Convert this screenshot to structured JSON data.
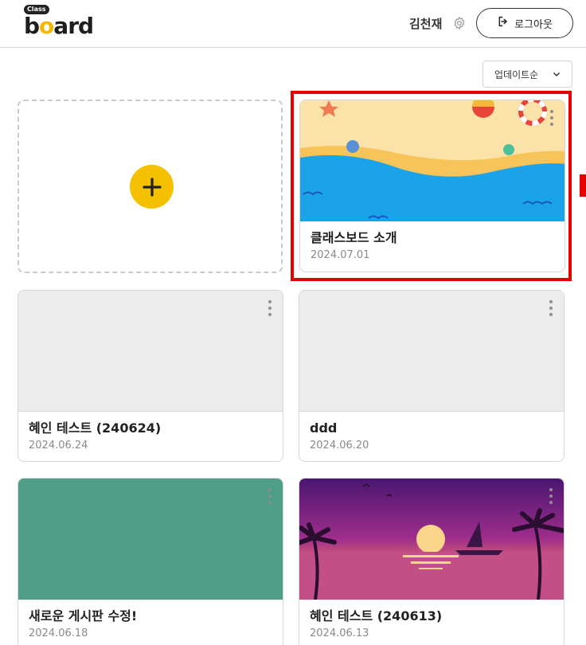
{
  "app": {
    "logo_badge": "Class",
    "logo_text_b": "b",
    "logo_text_o": "o",
    "logo_text_rest": "ard"
  },
  "header": {
    "user_name": "김천재",
    "logout_label": "로그아웃"
  },
  "sort": {
    "selected": "업데이트순"
  },
  "boards": [
    {
      "title": "클래스보드 소개",
      "date": "2024.07.01",
      "thumbnail": "beach"
    },
    {
      "title": "혜인 테스트 (240624)",
      "date": "2024.06.24",
      "thumbnail": "blank"
    },
    {
      "title": "ddd",
      "date": "2024.06.20",
      "thumbnail": "blank"
    },
    {
      "title": "새로운 게시판 수정!",
      "date": "2024.06.18",
      "thumbnail": "teal"
    },
    {
      "title": "혜인 테스트 (240613)",
      "date": "2024.06.13",
      "thumbnail": "sunset"
    }
  ],
  "colors": {
    "accent": "#f5c000",
    "highlight": "#e60000",
    "teal": "#4e9e88"
  },
  "icons": {
    "gear": "gear-icon",
    "logout": "logout-icon",
    "add": "plus-icon",
    "more": "kebab-icon"
  }
}
